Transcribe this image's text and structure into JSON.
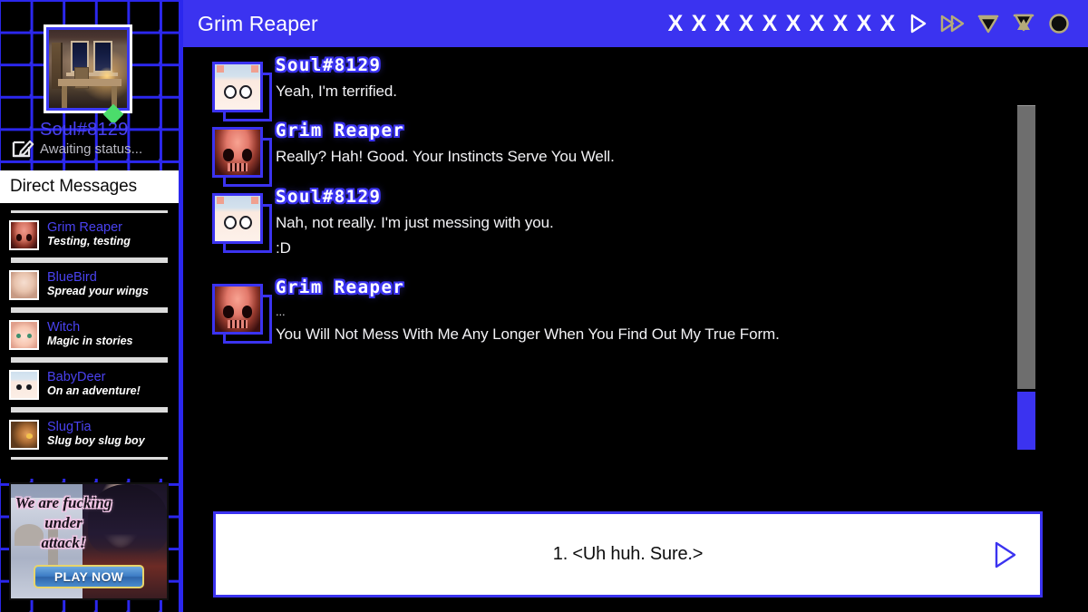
{
  "window": {
    "title": "Grim Reaper"
  },
  "colors": {
    "accent_blue": "#3b33f0",
    "grid_blue": "#2b27ee",
    "name_blue": "#4a42f0",
    "status_green": "#4bdc6b",
    "panel_black": "#000000",
    "panel_white": "#ffffff",
    "scrollbar_track": "#6e6e6e"
  },
  "sidebar": {
    "profile": {
      "name": "Soul#8129",
      "status": "Awaiting status...",
      "status_indicator": "online",
      "edit_icon": "pencil-square-icon",
      "avatar": "room-photo"
    },
    "section_header": "Direct Messages",
    "contacts": [
      {
        "name": "Grim Reaper",
        "preview": "Testing, testing",
        "avatar": "skull-avatar"
      },
      {
        "name": "BlueBird",
        "preview": "Spread your wings",
        "avatar": "blonde-avatar"
      },
      {
        "name": "Witch",
        "preview": "Magic in stories",
        "avatar": "witch-avatar"
      },
      {
        "name": "BabyDeer",
        "preview": "On an adventure!",
        "avatar": "deer-avatar"
      },
      {
        "name": "SlugTia",
        "preview": "Slug boy slug boy",
        "avatar": "slug-avatar"
      }
    ],
    "ad": {
      "headline_line1": "We are fucking",
      "headline_line2": "under",
      "headline_line3": "attack!",
      "button_label": "PLAY NOW"
    }
  },
  "header": {
    "title": "Grim Reaper",
    "health": {
      "symbol": "X",
      "count": 10
    },
    "controls": [
      {
        "name": "play-icon",
        "label": "Play"
      },
      {
        "name": "fast-forward-icon",
        "label": "Skip"
      },
      {
        "name": "save-icon",
        "label": "Save"
      },
      {
        "name": "load-icon",
        "label": "Load"
      },
      {
        "name": "record-icon",
        "label": "Record"
      }
    ]
  },
  "chat": {
    "messages": [
      {
        "author": "Soul#8129",
        "avatar": "soul-avatar",
        "lines": [
          "Yeah, I'm terrified."
        ]
      },
      {
        "author": "Grim Reaper",
        "avatar": "reaper-avatar",
        "lines": [
          "Really? Hah! Good. Your Instincts Serve You Well."
        ]
      },
      {
        "author": "Soul#8129",
        "avatar": "soul-avatar",
        "lines": [
          "Nah, not really. I'm just messing with you.",
          ":D"
        ]
      },
      {
        "author": "Grim Reaper",
        "avatar": "reaper-avatar",
        "lines": [
          "...",
          "You Will Not Mess With Me Any Longer When You Find Out My True Form."
        ]
      }
    ],
    "scrollbar": {
      "position": "bottom"
    }
  },
  "choice_box": {
    "text": "1. <Uh huh. Sure.>",
    "advance_icon": "play-triangle-icon"
  }
}
